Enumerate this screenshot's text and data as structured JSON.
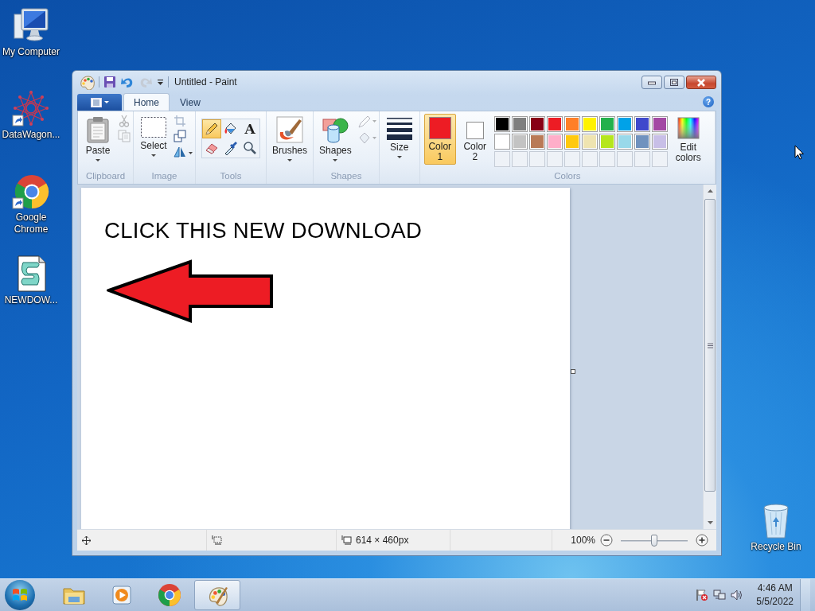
{
  "desktop_icons": [
    {
      "label": "My Computer",
      "kind": "computer",
      "shortcut": false
    },
    {
      "label": "DataWagon...",
      "kind": "network",
      "shortcut": true
    },
    {
      "label": "Google Chrome",
      "kind": "browser",
      "shortcut": true
    },
    {
      "label": "NEWDOW...",
      "kind": "script",
      "shortcut": false
    }
  ],
  "recycle_bin": {
    "label": "Recycle Bin"
  },
  "window": {
    "title": "Untitled - Paint",
    "help": "?"
  },
  "ribbon_tabs": [
    {
      "label": "Home",
      "selected": true
    },
    {
      "label": "View",
      "selected": false
    }
  ],
  "ribbon_groups": [
    {
      "kind": "standard",
      "label": "Clipboard",
      "buttons": [
        {
          "kind": "paste",
          "label": "Paste"
        },
        {
          "kind": "cut",
          "disabled": true
        },
        {
          "kind": "copy",
          "disabled": true
        }
      ]
    },
    {
      "kind": "standard",
      "label": "Image",
      "buttons": [
        {
          "kind": "select",
          "label": "Select"
        },
        {
          "kind": "crop",
          "disabled": true
        },
        {
          "kind": "resize",
          "disabled": false
        },
        {
          "kind": "rotate",
          "disabled": false
        }
      ]
    },
    {
      "kind": "tools",
      "label": "Tools",
      "buttons": [
        {
          "kind": "pencil",
          "selected": true
        },
        {
          "kind": "fill",
          "selected": false
        },
        {
          "kind": "text",
          "glyph": "A",
          "selected": false
        },
        {
          "kind": "eraser",
          "selected": false
        },
        {
          "kind": "picker",
          "selected": false
        },
        {
          "kind": "magnifier",
          "selected": false
        }
      ]
    },
    {
      "kind": "standard",
      "buttons": [
        {
          "kind": "brushes",
          "label": "Brushes"
        }
      ]
    },
    {
      "kind": "standard",
      "label": "Shapes",
      "buttons": [
        {
          "kind": "shapes",
          "label": "Shapes"
        },
        {
          "kind": "outline",
          "disabled": true
        },
        {
          "kind": "shape_fill",
          "disabled": true
        }
      ]
    },
    {
      "kind": "standard",
      "buttons": [
        {
          "kind": "size",
          "label": "Size"
        }
      ]
    },
    {
      "kind": "colors",
      "label": "Colors",
      "active_colors": [
        {
          "label": "Color 1",
          "color": "#ed1c24",
          "selected": true
        },
        {
          "label": "Color 2",
          "color": "#ffffff",
          "selected": false
        }
      ],
      "palette": [
        {
          "color": "#000000"
        },
        {
          "color": "#7f7f7f"
        },
        {
          "color": "#880015"
        },
        {
          "color": "#ed1c24"
        },
        {
          "color": "#ff7f27"
        },
        {
          "color": "#fff200"
        },
        {
          "color": "#22b14c"
        },
        {
          "color": "#00a2e8"
        },
        {
          "color": "#3f48cc"
        },
        {
          "color": "#a349a4"
        },
        {
          "color": "#ffffff"
        },
        {
          "color": "#c3c3c3"
        },
        {
          "color": "#b97a57"
        },
        {
          "color": "#ffaec9"
        },
        {
          "color": "#ffc90e"
        },
        {
          "color": "#efe4b0"
        },
        {
          "color": "#b5e61d"
        },
        {
          "color": "#99d9ea"
        },
        {
          "color": "#7092be"
        },
        {
          "color": "#c8bfe7"
        },
        {
          "kind": "empty"
        },
        {
          "kind": "empty"
        },
        {
          "kind": "empty"
        },
        {
          "kind": "empty"
        },
        {
          "kind": "empty"
        },
        {
          "kind": "empty"
        },
        {
          "kind": "empty"
        },
        {
          "kind": "empty"
        },
        {
          "kind": "empty"
        },
        {
          "kind": "empty"
        }
      ],
      "edit_button": {
        "label": "Edit colors"
      }
    }
  ],
  "canvas": {
    "text": "CLICK THIS NEW DOWNLOAD"
  },
  "status_bar": {
    "canvas_size": "614 × 460px",
    "zoom": "100%",
    "zoom_slider": {
      "level": 0.5
    }
  },
  "taskbar": {
    "items": [
      {
        "kind": "explorer",
        "selected": false
      },
      {
        "kind": "media",
        "selected": false
      },
      {
        "kind": "browser",
        "selected": false
      },
      {
        "kind": "paint",
        "selected": true
      }
    ],
    "time": "4:46 AM",
    "date": "5/5/2022"
  }
}
